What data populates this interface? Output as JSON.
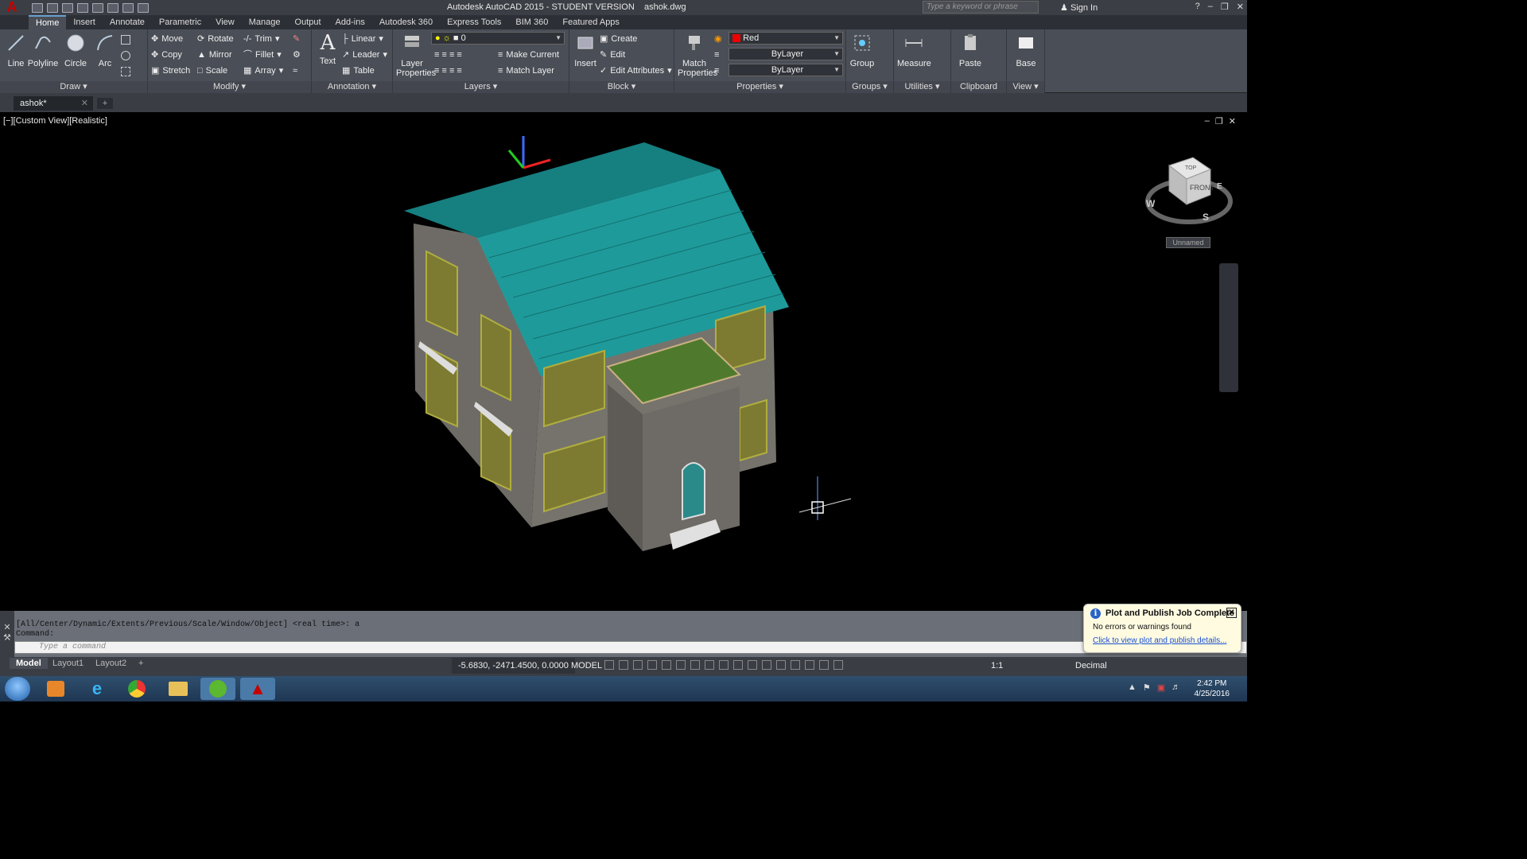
{
  "app": {
    "title": "Autodesk AutoCAD 2015 - STUDENT VERSION",
    "file": "ashok.dwg",
    "search_placeholder": "Type a keyword or phrase",
    "signin": "Sign In"
  },
  "ribbon_tabs": [
    "Home",
    "Insert",
    "Annotate",
    "Parametric",
    "View",
    "Manage",
    "Output",
    "Add-ins",
    "Autodesk 360",
    "Express Tools",
    "BIM 360",
    "Featured Apps"
  ],
  "ribbon": {
    "draw": {
      "title": "Draw",
      "line": "Line",
      "polyline": "Polyline",
      "circle": "Circle",
      "arc": "Arc"
    },
    "modify": {
      "title": "Modify",
      "move": "Move",
      "rotate": "Rotate",
      "trim": "Trim",
      "copy": "Copy",
      "mirror": "Mirror",
      "fillet": "Fillet",
      "stretch": "Stretch",
      "scale": "Scale",
      "array": "Array"
    },
    "annotation": {
      "title": "Annotation",
      "text": "Text",
      "linear": "Linear",
      "leader": "Leader",
      "table": "Table"
    },
    "layers": {
      "title": "Layers",
      "layer_properties_1": "Layer",
      "layer_properties_2": "Properties",
      "current_layer": "0",
      "make_current": "Make Current",
      "match_layer": "Match Layer"
    },
    "block": {
      "title": "Block",
      "insert": "Insert",
      "create": "Create",
      "edit": "Edit",
      "edit_attributes": "Edit Attributes"
    },
    "properties": {
      "title": "Properties",
      "match_1": "Match",
      "match_2": "Properties",
      "color": "Red",
      "linetype": "ByLayer",
      "lineweight": "ByLayer"
    },
    "groups": {
      "title": "Groups",
      "group": "Group"
    },
    "utilities": {
      "title": "Utilities",
      "measure": "Measure"
    },
    "clipboard": {
      "title": "Clipboard",
      "paste": "Paste"
    },
    "view": {
      "title": "View",
      "base": "Base"
    }
  },
  "document": {
    "tab": "ashok*"
  },
  "viewport": {
    "label": "[−][Custom View][Realistic]",
    "viewcube_top": "TOP",
    "viewcube_front": "FRONT",
    "compass_w": "W",
    "compass_s": "S",
    "compass_e": "E",
    "ucs_label": "Unnamed"
  },
  "command": {
    "history_1": "[All/Center/Dynamic/Extents/Previous/Scale/Window/Object] <real time>: a",
    "history_2": "Command:",
    "placeholder": "Type a command"
  },
  "layouts": [
    "Model",
    "Layout1",
    "Layout2"
  ],
  "status": {
    "coords": "-5.6830, -2471.4500, 0.0000",
    "model": "MODEL",
    "scale": "1:1",
    "units": "Decimal"
  },
  "notification": {
    "title": "Plot and Publish Job Complete",
    "body": "No errors or warnings found",
    "link": "Click to view plot and publish details..."
  },
  "clock": {
    "time": "2:42 PM",
    "date": "4/25/2016"
  },
  "colors": {
    "roof": "#1f9a9a",
    "wall": "#6e6b66",
    "window": "#8a8a2a",
    "accent": "#c40000"
  }
}
